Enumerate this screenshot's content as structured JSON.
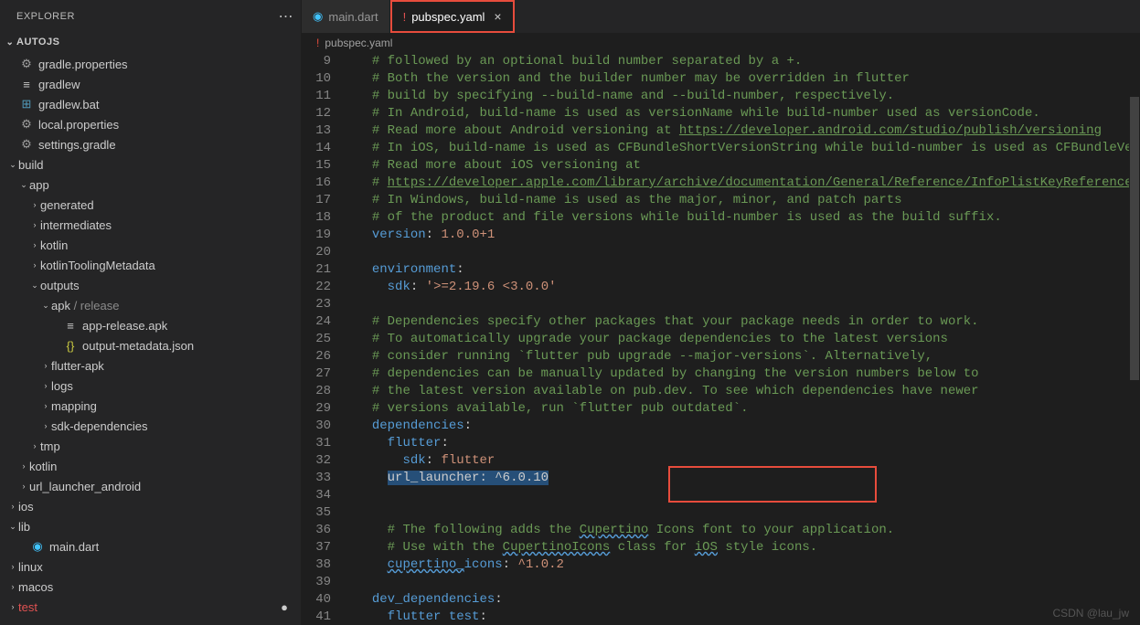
{
  "sidebar": {
    "title": "EXPLORER",
    "project": "AUTOJS",
    "items": [
      {
        "depth": 0,
        "chev": "",
        "icon": "⚙",
        "iconClass": "c-gear",
        "label": "gradle.properties"
      },
      {
        "depth": 0,
        "chev": "",
        "icon": "≡",
        "iconClass": "c-file",
        "label": "gradlew"
      },
      {
        "depth": 0,
        "chev": "",
        "icon": "⊞",
        "iconClass": "c-bat",
        "label": "gradlew.bat"
      },
      {
        "depth": 0,
        "chev": "",
        "icon": "⚙",
        "iconClass": "c-gear",
        "label": "local.properties"
      },
      {
        "depth": 0,
        "chev": "",
        "icon": "⚙",
        "iconClass": "c-gear",
        "label": "settings.gradle"
      },
      {
        "depth": 0,
        "chev": "⌄",
        "icon": "",
        "iconClass": "",
        "label": "build"
      },
      {
        "depth": 1,
        "chev": "⌄",
        "icon": "",
        "iconClass": "",
        "label": "app"
      },
      {
        "depth": 2,
        "chev": "›",
        "icon": "",
        "iconClass": "",
        "label": "generated"
      },
      {
        "depth": 2,
        "chev": "›",
        "icon": "",
        "iconClass": "",
        "label": "intermediates"
      },
      {
        "depth": 2,
        "chev": "›",
        "icon": "",
        "iconClass": "",
        "label": "kotlin"
      },
      {
        "depth": 2,
        "chev": "›",
        "icon": "",
        "iconClass": "",
        "label": "kotlinToolingMetadata"
      },
      {
        "depth": 2,
        "chev": "⌄",
        "icon": "",
        "iconClass": "",
        "label": "outputs"
      },
      {
        "depth": 3,
        "chev": "⌄",
        "icon": "",
        "iconClass": "",
        "label": "apk / release",
        "labelMuted": "/ release"
      },
      {
        "depth": 4,
        "chev": "",
        "icon": "≡",
        "iconClass": "c-file",
        "label": "app-release.apk"
      },
      {
        "depth": 4,
        "chev": "",
        "icon": "{}",
        "iconClass": "c-json",
        "label": "output-metadata.json"
      },
      {
        "depth": 3,
        "chev": "›",
        "icon": "",
        "iconClass": "",
        "label": "flutter-apk"
      },
      {
        "depth": 3,
        "chev": "›",
        "icon": "",
        "iconClass": "",
        "label": "logs"
      },
      {
        "depth": 3,
        "chev": "›",
        "icon": "",
        "iconClass": "",
        "label": "mapping"
      },
      {
        "depth": 3,
        "chev": "›",
        "icon": "",
        "iconClass": "",
        "label": "sdk-dependencies"
      },
      {
        "depth": 2,
        "chev": "›",
        "icon": "",
        "iconClass": "",
        "label": "tmp"
      },
      {
        "depth": 1,
        "chev": "›",
        "icon": "",
        "iconClass": "",
        "label": "kotlin"
      },
      {
        "depth": 1,
        "chev": "›",
        "icon": "",
        "iconClass": "",
        "label": "url_launcher_android"
      },
      {
        "depth": 0,
        "chev": "›",
        "icon": "",
        "iconClass": "",
        "label": "ios"
      },
      {
        "depth": 0,
        "chev": "⌄",
        "icon": "",
        "iconClass": "",
        "label": "lib"
      },
      {
        "depth": 1,
        "chev": "",
        "icon": "◉",
        "iconClass": "c-dart",
        "label": "main.dart"
      },
      {
        "depth": 0,
        "chev": "›",
        "icon": "",
        "iconClass": "",
        "label": "linux"
      },
      {
        "depth": 0,
        "chev": "›",
        "icon": "",
        "iconClass": "",
        "label": "macos"
      },
      {
        "depth": 0,
        "chev": "›",
        "icon": "",
        "iconClass": "c-red",
        "label": "test",
        "labelClass": "c-red",
        "dot": "●"
      }
    ]
  },
  "tabs": [
    {
      "icon": "◉",
      "iconClass": "c-dart",
      "label": "main.dart",
      "active": false
    },
    {
      "icon": "!",
      "iconClass": "c-red",
      "label": "pubspec.yaml",
      "active": true,
      "close": "×",
      "highlight": true
    }
  ],
  "breadcrumb": {
    "icon": "!",
    "label": "pubspec.yaml"
  },
  "editor": {
    "startLine": 9,
    "lines": [
      [
        {
          "t": "  ",
          "c": ""
        },
        {
          "t": "# followed by an optional build number separated by a +.",
          "c": "tok-comment"
        }
      ],
      [
        {
          "t": "  ",
          "c": ""
        },
        {
          "t": "# Both the version and the builder number may be overridden in flutter",
          "c": "tok-comment"
        }
      ],
      [
        {
          "t": "  ",
          "c": ""
        },
        {
          "t": "# build by specifying --build-name and --build-number, respectively.",
          "c": "tok-comment"
        }
      ],
      [
        {
          "t": "  ",
          "c": ""
        },
        {
          "t": "# In Android, build-name is used as versionName while build-number used as versionCode.",
          "c": "tok-comment"
        }
      ],
      [
        {
          "t": "  ",
          "c": ""
        },
        {
          "t": "# Read more about Android versioning at ",
          "c": "tok-comment"
        },
        {
          "t": "https://developer.android.com/studio/publish/versioning",
          "c": "tok-link"
        }
      ],
      [
        {
          "t": "  ",
          "c": ""
        },
        {
          "t": "# In iOS, build-name is used as CFBundleShortVersionString while build-number is used as CFBundleVer",
          "c": "tok-comment"
        }
      ],
      [
        {
          "t": "  ",
          "c": ""
        },
        {
          "t": "# Read more about iOS versioning at",
          "c": "tok-comment"
        }
      ],
      [
        {
          "t": "  ",
          "c": ""
        },
        {
          "t": "# ",
          "c": "tok-comment"
        },
        {
          "t": "https://developer.apple.com/library/archive/documentation/General/Reference/InfoPlistKeyReference/",
          "c": "tok-link"
        }
      ],
      [
        {
          "t": "  ",
          "c": ""
        },
        {
          "t": "# In Windows, build-name is used as the major, minor, and patch parts",
          "c": "tok-comment"
        }
      ],
      [
        {
          "t": "  ",
          "c": ""
        },
        {
          "t": "# of the product and file versions while build-number is used as the build suffix.",
          "c": "tok-comment"
        }
      ],
      [
        {
          "t": "  ",
          "c": ""
        },
        {
          "t": "version",
          "c": "tok-key"
        },
        {
          "t": ": ",
          "c": ""
        },
        {
          "t": "1.0.0+1",
          "c": "tok-string"
        }
      ],
      [
        {
          "t": "",
          "c": ""
        }
      ],
      [
        {
          "t": "  ",
          "c": ""
        },
        {
          "t": "environment",
          "c": "tok-key"
        },
        {
          "t": ":",
          "c": ""
        }
      ],
      [
        {
          "t": "    ",
          "c": ""
        },
        {
          "t": "sdk",
          "c": "tok-key"
        },
        {
          "t": ": ",
          "c": ""
        },
        {
          "t": "'>=2.19.6 <3.0.0'",
          "c": "tok-string"
        }
      ],
      [
        {
          "t": "",
          "c": ""
        }
      ],
      [
        {
          "t": "  ",
          "c": ""
        },
        {
          "t": "# Dependencies specify other packages that your package needs in order to work.",
          "c": "tok-comment"
        }
      ],
      [
        {
          "t": "  ",
          "c": ""
        },
        {
          "t": "# To automatically upgrade your package dependencies to the latest versions",
          "c": "tok-comment"
        }
      ],
      [
        {
          "t": "  ",
          "c": ""
        },
        {
          "t": "# consider running `flutter pub upgrade --major-versions`. Alternatively,",
          "c": "tok-comment"
        }
      ],
      [
        {
          "t": "  ",
          "c": ""
        },
        {
          "t": "# dependencies can be manually updated by changing the version numbers below to",
          "c": "tok-comment"
        }
      ],
      [
        {
          "t": "  ",
          "c": ""
        },
        {
          "t": "# the latest version available on pub.dev. To see which dependencies have newer",
          "c": "tok-comment"
        }
      ],
      [
        {
          "t": "  ",
          "c": ""
        },
        {
          "t": "# versions available, run `flutter pub outdated`.",
          "c": "tok-comment"
        }
      ],
      [
        {
          "t": "  ",
          "c": ""
        },
        {
          "t": "dependencies",
          "c": "tok-key"
        },
        {
          "t": ":",
          "c": ""
        }
      ],
      [
        {
          "t": "    ",
          "c": ""
        },
        {
          "t": "flutter",
          "c": "tok-key"
        },
        {
          "t": ":",
          "c": ""
        }
      ],
      [
        {
          "t": "      ",
          "c": ""
        },
        {
          "t": "sdk",
          "c": "tok-key"
        },
        {
          "t": ": ",
          "c": ""
        },
        {
          "t": "flutter",
          "c": "tok-string"
        }
      ],
      [
        {
          "t": "    ",
          "c": ""
        },
        {
          "t": "url_launcher: ^6.0.10",
          "c": "tok-sel"
        }
      ],
      [
        {
          "t": "",
          "c": ""
        }
      ],
      [
        {
          "t": "",
          "c": ""
        }
      ],
      [
        {
          "t": "    ",
          "c": ""
        },
        {
          "t": "# The following adds the ",
          "c": "tok-comment"
        },
        {
          "t": "Cupertino",
          "c": "tok-comment tok-wavy"
        },
        {
          "t": " Icons font to your application.",
          "c": "tok-comment"
        }
      ],
      [
        {
          "t": "    ",
          "c": ""
        },
        {
          "t": "# Use with the ",
          "c": "tok-comment"
        },
        {
          "t": "CupertinoIcons",
          "c": "tok-comment tok-wavy"
        },
        {
          "t": " class for ",
          "c": "tok-comment"
        },
        {
          "t": "iOS",
          "c": "tok-comment tok-wavy"
        },
        {
          "t": " style icons.",
          "c": "tok-comment"
        }
      ],
      [
        {
          "t": "    ",
          "c": ""
        },
        {
          "t": "cupertino_",
          "c": "tok-key tok-wavy"
        },
        {
          "t": "icons",
          "c": "tok-key"
        },
        {
          "t": ": ",
          "c": ""
        },
        {
          "t": "^1.0.2",
          "c": "tok-string"
        }
      ],
      [
        {
          "t": "",
          "c": ""
        }
      ],
      [
        {
          "t": "  ",
          "c": ""
        },
        {
          "t": "dev_dependencies",
          "c": "tok-key"
        },
        {
          "t": ":",
          "c": ""
        }
      ],
      [
        {
          "t": "    ",
          "c": ""
        },
        {
          "t": "flutter test",
          "c": "tok-key"
        },
        {
          "t": ":",
          "c": ""
        }
      ]
    ]
  },
  "watermark": "CSDN @lau_jw"
}
